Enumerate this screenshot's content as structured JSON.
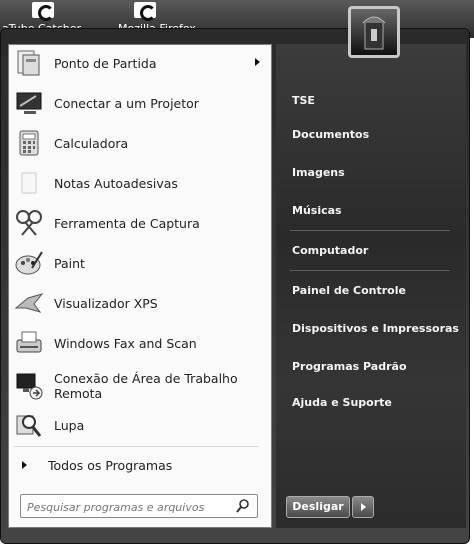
{
  "desktop": {
    "icons": [
      {
        "label": "aTube Catcher"
      },
      {
        "label": "Mozilla Firefox"
      }
    ]
  },
  "programs": [
    {
      "label": "Ponto de Partida",
      "icon": "getting-started-icon",
      "submenu": true
    },
    {
      "label": "Conectar a um Projetor",
      "icon": "projector-icon"
    },
    {
      "label": "Calculadora",
      "icon": "calculator-icon"
    },
    {
      "label": "Notas Autoadesivas",
      "icon": "sticky-notes-icon"
    },
    {
      "label": "Ferramenta de Captura",
      "icon": "scissors-icon"
    },
    {
      "label": "Paint",
      "icon": "paint-palette-icon"
    },
    {
      "label": "Visualizador XPS",
      "icon": "xps-viewer-icon"
    },
    {
      "label": "Windows Fax and Scan",
      "icon": "fax-scanner-icon"
    },
    {
      "label": "Conexão de Área de Trabalho Remota",
      "line1": "Conexão de Área de Trabalho",
      "line2": "Remota",
      "icon": "remote-desktop-icon"
    },
    {
      "label": "Lupa",
      "icon": "magnifier-icon"
    }
  ],
  "all_programs": "Todos os Programas",
  "search": {
    "placeholder": "Pesquisar programas e arquivos",
    "value": ""
  },
  "right_menu": [
    "TSE",
    "Documentos",
    "Imagens",
    "Músicas",
    "Computador",
    "Painel de Controle",
    "Dispositivos e Impressoras",
    "Programas Padrão",
    "Ajuda e Suporte"
  ],
  "shutdown": {
    "label": "Desligar"
  }
}
